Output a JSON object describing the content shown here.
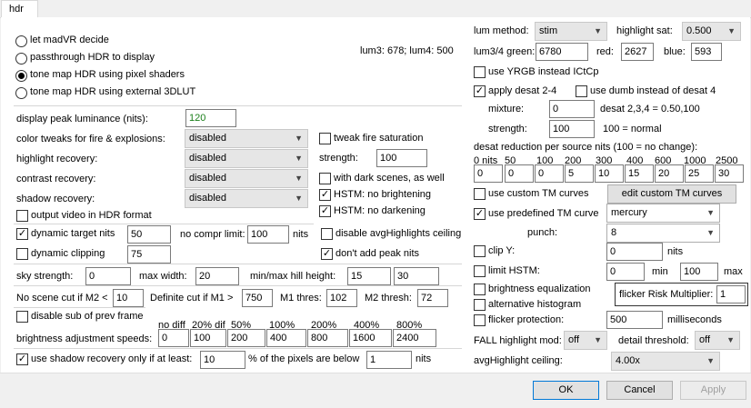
{
  "tab": {
    "label": "hdr"
  },
  "left": {
    "radios": [
      {
        "label": "let madVR decide",
        "checked": false
      },
      {
        "label": "passthrough HDR to display",
        "checked": false
      },
      {
        "label": "tone map HDR using pixel shaders",
        "checked": true
      },
      {
        "label": "tone map HDR using external 3DLUT",
        "checked": false
      }
    ],
    "lum_info": "lum3: 678; lum4: 500",
    "display_peak": {
      "label": "display peak luminance (nits):",
      "value": "120"
    },
    "color_tweaks": {
      "label": "color tweaks for fire & explosions:",
      "value": "disabled"
    },
    "highlight_recovery": {
      "label": "highlight recovery:",
      "value": "disabled"
    },
    "contrast_recovery": {
      "label": "contrast recovery:",
      "value": "disabled"
    },
    "shadow_recovery": {
      "label": "shadow recovery:",
      "value": "disabled"
    },
    "tweak_fire": {
      "label": "tweak fire saturation",
      "checked": false
    },
    "strength": {
      "label": "strength:",
      "value": "100"
    },
    "dark_scenes": {
      "label": "with dark scenes, as well",
      "checked": false
    },
    "hstm_bright": {
      "label": "HSTM: no brightening",
      "checked": true
    },
    "hstm_dark": {
      "label": "HSTM: no darkening",
      "checked": true
    },
    "output_hdr": {
      "label": "output video in HDR format",
      "checked": false
    },
    "dyn_target": {
      "label": "dynamic target nits",
      "checked": true,
      "value": "50"
    },
    "no_compr": {
      "label": "no compr limit:",
      "value": "100",
      "unit": "nits"
    },
    "disable_avg": {
      "label": "disable avgHighlights ceiling",
      "checked": false
    },
    "dyn_clip": {
      "label": "dynamic clipping",
      "checked": false,
      "value": "75"
    },
    "dont_add_peak": {
      "label": "don't add peak nits",
      "checked": true
    },
    "sky": {
      "label": "sky strength:",
      "value": "0",
      "max_width_label": "max width:",
      "max_width": "20",
      "hill_label": "min/max hill height:",
      "hill_min": "15",
      "hill_max": "30"
    },
    "scene_cut": {
      "label": "No scene cut if M2 <",
      "value": "10",
      "definite_label": "Definite cut if M1 >",
      "definite": "750",
      "m1_label": "M1 thres:",
      "m1": "102",
      "m2_label": "M2 thresh:",
      "m2": "72"
    },
    "disable_sub": {
      "label": "disable sub of prev frame",
      "checked": false
    },
    "speeds": {
      "label": "brightness adjustment speeds:",
      "headers": [
        "no diff",
        "20% dif",
        "50%",
        "100%",
        "200%",
        "400%",
        "800%"
      ],
      "values": [
        "0",
        "100",
        "200",
        "400",
        "800",
        "1600",
        "2400"
      ]
    },
    "shadow_only": {
      "label": "use shadow recovery only if at least:",
      "checked": true,
      "value": "10",
      "mid": "% of the pixels are below",
      "nits_value": "1",
      "unit": "nits"
    }
  },
  "right": {
    "lum_method": {
      "label": "lum method:",
      "value": "stim"
    },
    "highlight_sat": {
      "label": "highlight sat:",
      "value": "0.500"
    },
    "lum34_green": {
      "label": "lum3/4 green:",
      "value": "6780"
    },
    "red": {
      "label": "red:",
      "value": "2627"
    },
    "blue": {
      "label": "blue:",
      "value": "593"
    },
    "use_yrgb": {
      "label": "use YRGB instead ICtCp",
      "checked": false
    },
    "apply_desat": {
      "label": "apply desat 2-4",
      "checked": true
    },
    "use_dumb": {
      "label": "use dumb instead of desat 4",
      "checked": false
    },
    "mixture": {
      "label": "mixture:",
      "value": "0",
      "note": "desat 2,3,4 = 0.50,100"
    },
    "strength": {
      "label": "strength:",
      "value": "100",
      "note": "100 = normal"
    },
    "desat_reduction": {
      "label": "desat reduction per source nits (100 = no change):",
      "headers": [
        "0 nits",
        "50",
        "100",
        "200",
        "300",
        "400",
        "600",
        "1000",
        "2500"
      ],
      "values": [
        "0",
        "0",
        "0",
        "5",
        "10",
        "15",
        "20",
        "25",
        "30"
      ]
    },
    "custom_tm": {
      "label": "use custom TM curves",
      "checked": false,
      "button": "edit custom TM curves"
    },
    "predefined_tm": {
      "label": "use predefined TM curve",
      "checked": true,
      "value": "mercury"
    },
    "punch": {
      "label": "punch:",
      "value": "8"
    },
    "clip_y": {
      "label": "clip Y:",
      "checked": false,
      "value": "0",
      "unit": "nits"
    },
    "limit_hstm": {
      "label": "limit HSTM:",
      "checked": false,
      "value": "0",
      "min_label": "min",
      "max_value": "100",
      "max_label": "max"
    },
    "brightness_eq": {
      "label": "brightness equalization",
      "checked": false
    },
    "flicker_risk": {
      "label": "flicker Risk Multiplier:",
      "value": "1"
    },
    "alt_hist": {
      "label": "alternative histogram",
      "checked": false
    },
    "flicker_prot": {
      "label": "flicker protection:",
      "checked": false,
      "value": "500",
      "unit": "milliseconds"
    },
    "fall_mod": {
      "label": "FALL highlight mod:",
      "value": "off"
    },
    "detail_thresh": {
      "label": "detail threshold:",
      "value": "off"
    },
    "avg_ceiling": {
      "label": "avgHighlight ceiling:",
      "value": "4.00x"
    }
  },
  "buttons": {
    "ok": "OK",
    "cancel": "Cancel",
    "apply": "Apply"
  }
}
